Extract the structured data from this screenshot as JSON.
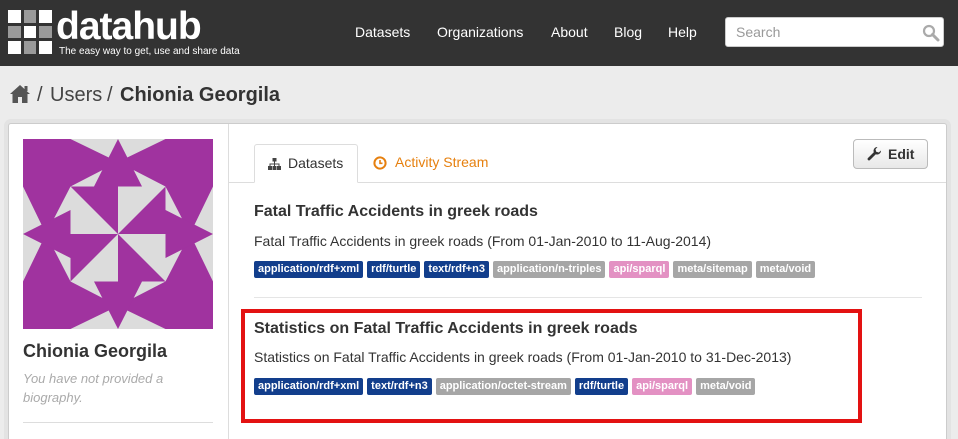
{
  "header": {
    "logo_text": "datahub",
    "logo_tagline": "The easy way to get, use and share data",
    "nav": [
      "Datasets",
      "Organizations",
      "About",
      "Blog",
      "Help"
    ],
    "search_placeholder": "Search"
  },
  "breadcrumb": {
    "items": [
      "Users",
      "Chionia Georgila"
    ],
    "separator": "/"
  },
  "profile": {
    "name": "Chionia Georgila",
    "bio": "You have not provided a biography."
  },
  "tabs": {
    "datasets": "Datasets",
    "activity": "Activity Stream",
    "edit_label": "Edit"
  },
  "datasets": [
    {
      "title": "Fatal Traffic Accidents in greek roads",
      "notes": "Fatal Traffic Accidents in greek roads (From 01-Jan-2010 to 11-Aug-2014)",
      "tags": [
        {
          "label": "application/rdf+xml",
          "color": "#123e8c"
        },
        {
          "label": "rdf/turtle",
          "color": "#123e8c"
        },
        {
          "label": "text/rdf+n3",
          "color": "#123e8c"
        },
        {
          "label": "application/n-triples",
          "color": "#a6a6a6"
        },
        {
          "label": "api/sparql",
          "color": "#e391c3"
        },
        {
          "label": "meta/sitemap",
          "color": "#a6a6a6"
        },
        {
          "label": "meta/void",
          "color": "#a6a6a6"
        }
      ]
    },
    {
      "title": "Statistics on Fatal Traffic Accidents in greek roads",
      "notes": "Statistics on Fatal Traffic Accidents in greek roads (From 01-Jan-2010 to 31-Dec-2013)",
      "tags": [
        {
          "label": "application/rdf+xml",
          "color": "#123e8c"
        },
        {
          "label": "text/rdf+n3",
          "color": "#123e8c"
        },
        {
          "label": "application/octet-stream",
          "color": "#a6a6a6"
        },
        {
          "label": "rdf/turtle",
          "color": "#123e8c"
        },
        {
          "label": "api/sparql",
          "color": "#e391c3"
        },
        {
          "label": "meta/void",
          "color": "#a6a6a6"
        }
      ]
    }
  ],
  "colors": {
    "header_bg": "#333333",
    "activity_tab": "#e6800f",
    "avatar": "#a0339f",
    "highlight": "#e31212"
  }
}
